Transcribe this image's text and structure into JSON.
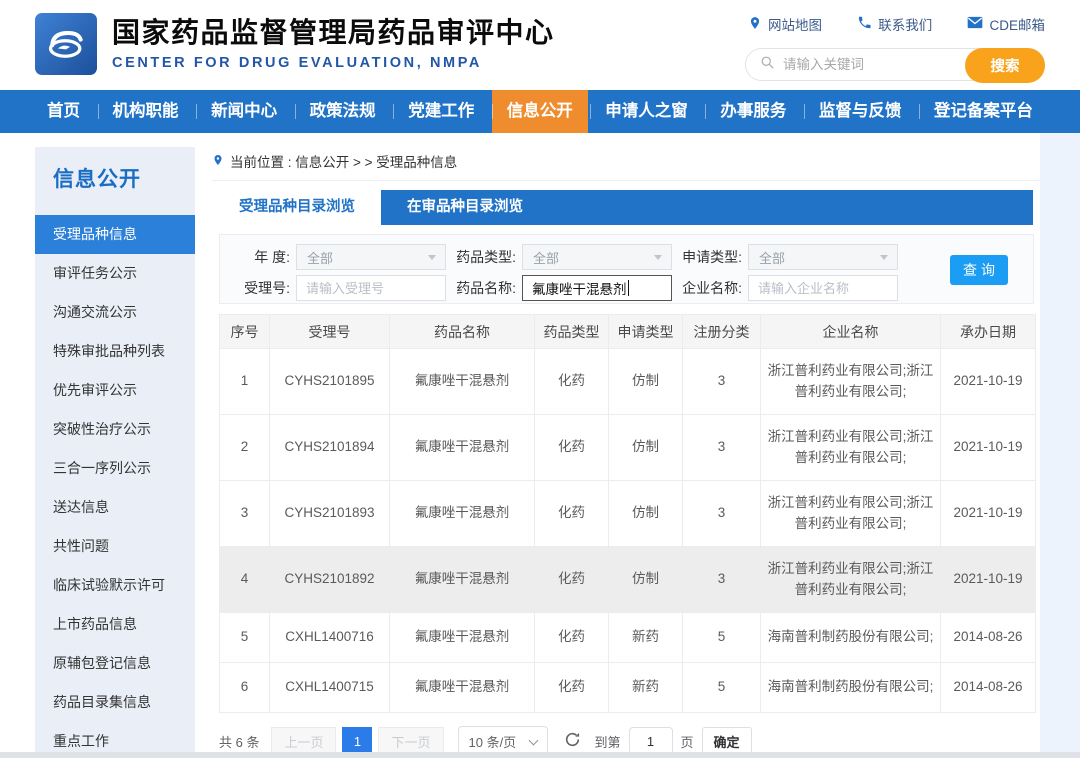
{
  "header": {
    "title_cn": "国家药品监督管理局药品审评中心",
    "title_en": "CENTER FOR DRUG EVALUATION, NMPA",
    "quick_links": [
      {
        "label": "网站地图",
        "icon": "location-pin-icon"
      },
      {
        "label": "联系我们",
        "icon": "phone-icon"
      },
      {
        "label": "CDE邮箱",
        "icon": "mail-icon"
      }
    ],
    "search_placeholder": "请输入关键词",
    "search_button": "搜索"
  },
  "nav": {
    "items": [
      "首页",
      "机构职能",
      "新闻中心",
      "政策法规",
      "党建工作",
      "信息公开",
      "申请人之窗",
      "办事服务",
      "监督与反馈",
      "登记备案平台"
    ],
    "active_item": "信息公开"
  },
  "sidebar": {
    "title": "信息公开",
    "active_item": "受理品种信息",
    "items": [
      "受理品种信息",
      "审评任务公示",
      "沟通交流公示",
      "特殊审批品种列表",
      "优先审评公示",
      "突破性治疗公示",
      "三合一序列公示",
      "送达信息",
      "共性问题",
      "临床试验默示许可",
      "上市药品信息",
      "原辅包登记信息",
      "药品目录集信息",
      "重点工作"
    ]
  },
  "breadcrumb": {
    "label": "当前位置 : 信息公开 > > 受理品种信息"
  },
  "tabs": {
    "tab1": "受理品种目录浏览",
    "tab2": "在审品种目录浏览",
    "active": "受理品种目录浏览"
  },
  "filters": {
    "year_label": "年 度:",
    "year_value": "全部",
    "drug_type_label": "药品类型:",
    "drug_type_value": "全部",
    "apply_type_label": "申请类型:",
    "apply_type_value": "全部",
    "acceptance_label": "受理号:",
    "acceptance_placeholder": "请输入受理号",
    "drug_name_label": "药品名称:",
    "drug_name_value": "氟康唑干混悬剂",
    "company_label": "企业名称:",
    "company_placeholder": "请输入企业名称",
    "query_button": "查询"
  },
  "table": {
    "columns": [
      "序号",
      "受理号",
      "药品名称",
      "药品类型",
      "申请类型",
      "注册分类",
      "企业名称",
      "承办日期"
    ],
    "rows": [
      [
        "1",
        "CYHS2101895",
        "氟康唑干混悬剂",
        "化药",
        "仿制",
        "3",
        "浙江普利药业有限公司;浙江普利药业有限公司;",
        "2021-10-19"
      ],
      [
        "2",
        "CYHS2101894",
        "氟康唑干混悬剂",
        "化药",
        "仿制",
        "3",
        "浙江普利药业有限公司;浙江普利药业有限公司;",
        "2021-10-19"
      ],
      [
        "3",
        "CYHS2101893",
        "氟康唑干混悬剂",
        "化药",
        "仿制",
        "3",
        "浙江普利药业有限公司;浙江普利药业有限公司;",
        "2021-10-19"
      ],
      [
        "4",
        "CYHS2101892",
        "氟康唑干混悬剂",
        "化药",
        "仿制",
        "3",
        "浙江普利药业有限公司;浙江普利药业有限公司;",
        "2021-10-19"
      ],
      [
        "5",
        "CXHL1400716",
        "氟康唑干混悬剂",
        "化药",
        "新药",
        "5",
        "海南普利制药股份有限公司;",
        "2014-08-26"
      ],
      [
        "6",
        "CXHL1400715",
        "氟康唑干混悬剂",
        "化药",
        "新药",
        "5",
        "海南普利制药股份有限公司;",
        "2014-08-26"
      ]
    ],
    "highlighted_row": "4"
  },
  "pagination": {
    "total": "共 6 条",
    "prev": "上一页",
    "page": "1",
    "next": "下一页",
    "page_size": "10 条/页",
    "goto_label": "到第",
    "goto_value": "1",
    "goto_unit": "页",
    "confirm": "确定"
  },
  "colors": {
    "nav_blue": "#2173c7",
    "active_orange": "#ee8c2e",
    "search_orange": "#f9a31c",
    "icon_blue": "#2372c8",
    "query_blue": "#1b9df3",
    "pagination_blue": "#2b7ce9",
    "sidebar_active_blue": "#2b80d9"
  }
}
